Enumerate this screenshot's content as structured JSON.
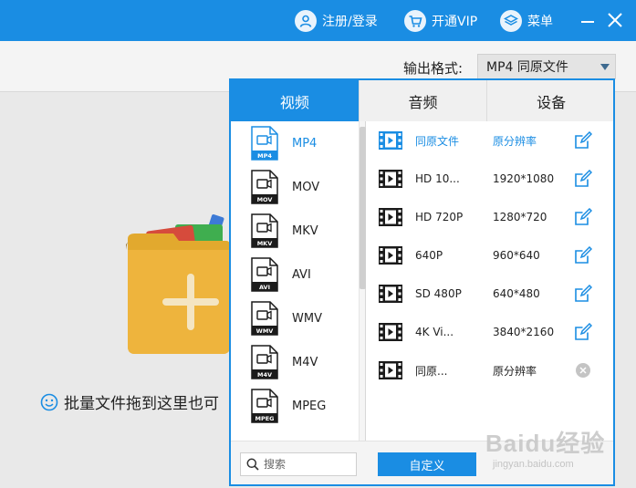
{
  "titlebar": {
    "register_label": "注册/登录",
    "vip_label": "开通VIP",
    "menu_label": "菜单",
    "accent": "#1a8de3"
  },
  "toolbar": {
    "output_label": "输出格式:",
    "output_value": "MP4  同原文件"
  },
  "workarea": {
    "drop_hint": "批量文件拖到这里也可"
  },
  "popup": {
    "tabs": [
      {
        "label": "视频",
        "active": true
      },
      {
        "label": "音频",
        "active": false
      },
      {
        "label": "设备",
        "active": false
      }
    ],
    "formats": [
      {
        "label": "MP4",
        "badge": "MP4",
        "active": true
      },
      {
        "label": "MOV",
        "badge": "MOV",
        "active": false
      },
      {
        "label": "MKV",
        "badge": "MKV",
        "active": false
      },
      {
        "label": "AVI",
        "badge": "AVI",
        "active": false
      },
      {
        "label": "WMV",
        "badge": "WMV",
        "active": false
      },
      {
        "label": "M4V",
        "badge": "M4V",
        "active": false
      },
      {
        "label": "MPEG",
        "badge": "MPEG",
        "active": false
      }
    ],
    "resolutions": [
      {
        "name": "同原文件",
        "value": "原分辨率",
        "action": "edit",
        "active": true
      },
      {
        "name": "HD 10...",
        "value": "1920*1080",
        "action": "edit",
        "active": false
      },
      {
        "name": "HD 720P",
        "value": "1280*720",
        "action": "edit",
        "active": false
      },
      {
        "name": "640P",
        "value": "960*640",
        "action": "edit",
        "active": false
      },
      {
        "name": "SD 480P",
        "value": "640*480",
        "action": "edit",
        "active": false
      },
      {
        "name": "4K Vi...",
        "value": "3840*2160",
        "action": "edit",
        "active": false
      },
      {
        "name": "同原...",
        "value": "原分辨率",
        "action": "delete",
        "active": false
      }
    ],
    "search_placeholder": "搜索",
    "custom_label": "自定义"
  },
  "watermark": {
    "main": "Baidu经验",
    "sub": "jingyan.baidu.com"
  }
}
